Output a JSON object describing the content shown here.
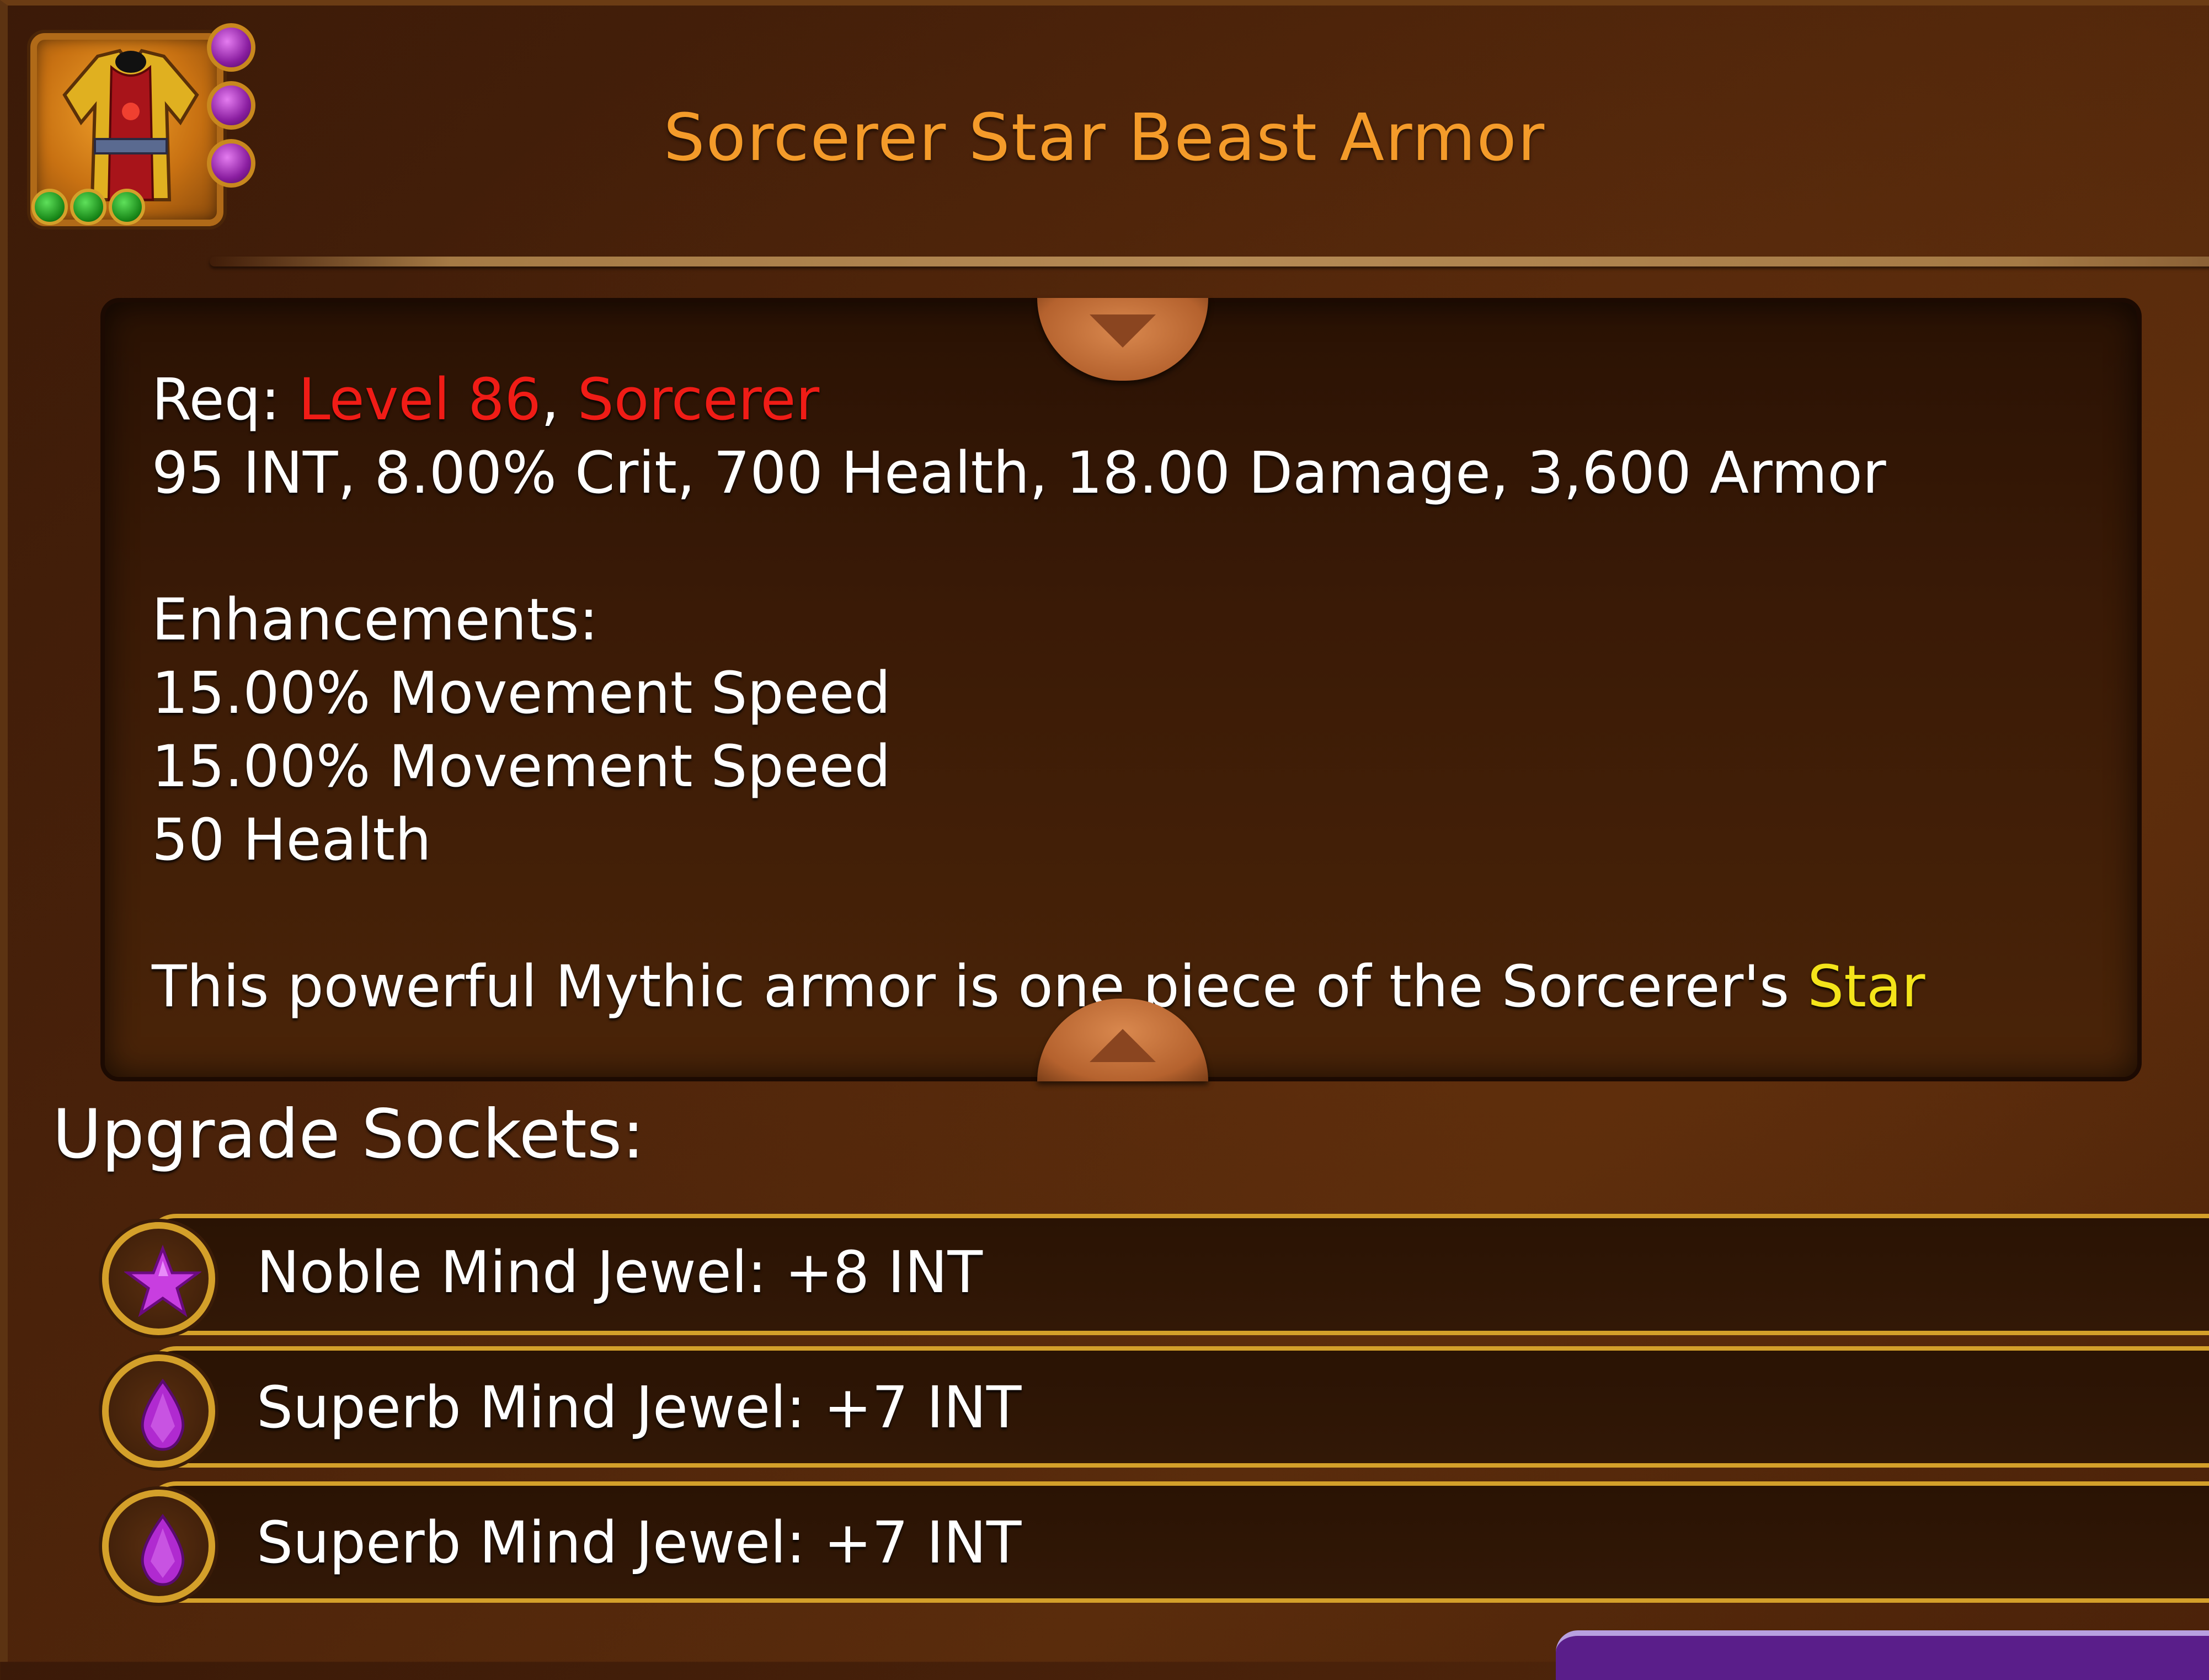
{
  "item": {
    "title": "Sorcerer Star Beast Armor",
    "icon": "armor-icon",
    "socket_gem_icons": [
      "purple-star-gem-icon",
      "purple-gem-icon",
      "purple-gem-icon"
    ],
    "level_pips": 3
  },
  "description": {
    "req_label": "Req: ",
    "req_level": "Level 86",
    "req_sep": ", ",
    "req_class": "Sorcerer",
    "stats": "95 INT, 8.00% Crit, 700 Health, 18.00 Damage, 3,600 Armor",
    "enhancements_heading": "Enhancements:",
    "enhancements": [
      "15.00% Movement Speed",
      "15.00% Movement Speed",
      "50 Health"
    ],
    "flavor_prefix": "This powerful Mythic armor is one piece of the Sorcerer's ",
    "flavor_highlight": "Star"
  },
  "sockets": {
    "heading": "Upgrade Sockets:",
    "items": [
      {
        "label": "Noble Mind Jewel: +8 INT",
        "icon": "star-jewel-icon"
      },
      {
        "label": "Superb Mind Jewel: +7 INT",
        "icon": "teardrop-jewel-icon"
      },
      {
        "label": "Superb Mind Jewel: +7 INT",
        "icon": "teardrop-jewel-icon"
      }
    ]
  },
  "colors": {
    "title": "#f49b2a",
    "requirement": "#f01c16",
    "highlight": "#f4e41a",
    "gold_border": "#d4a02a",
    "jewel": "#b02ad0"
  }
}
